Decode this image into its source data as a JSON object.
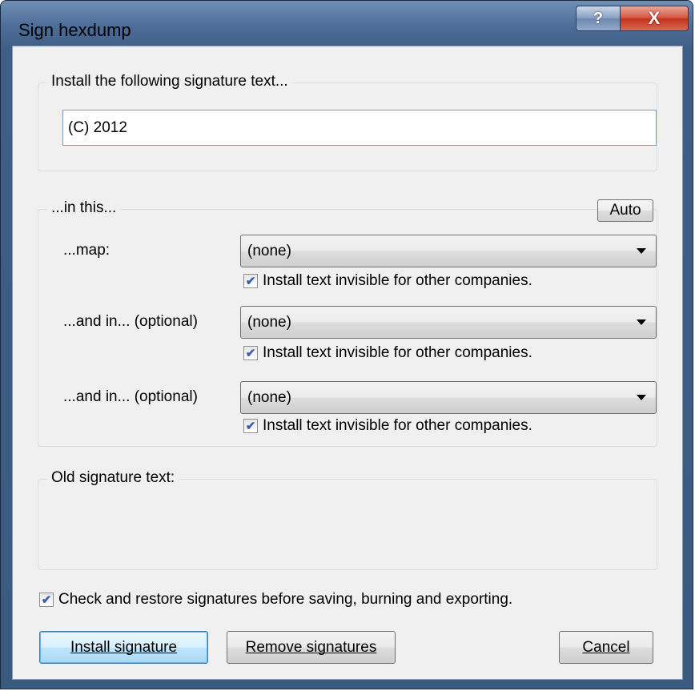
{
  "window": {
    "title": "Sign hexdump",
    "help_button": "?",
    "close_button": "X"
  },
  "signature_group": {
    "legend": "Install the following signature text...",
    "text_value": "(C) 2012"
  },
  "target_group": {
    "legend": "...in this...",
    "auto_button": "Auto",
    "rows": [
      {
        "label": "...map:",
        "combo_value": "(none)",
        "checkbox_label": "Install text invisible for other companies.",
        "checked": true
      },
      {
        "label": "...and in... (optional)",
        "combo_value": "(none)",
        "checkbox_label": "Install text invisible for other companies.",
        "checked": true
      },
      {
        "label": "...and in... (optional)",
        "combo_value": "(none)",
        "checkbox_label": "Install text invisible for other companies.",
        "checked": true
      }
    ]
  },
  "old_signature_group": {
    "legend": "Old signature text:",
    "text": ""
  },
  "check_restore": {
    "label": "Check and restore signatures before saving, burning and exporting.",
    "checked": true
  },
  "buttons": {
    "install": "Install signature",
    "remove": "Remove signatures",
    "cancel": "Cancel"
  },
  "icons": {
    "combo_arrow": "chevron-down-icon",
    "checkmark": "check-icon"
  }
}
